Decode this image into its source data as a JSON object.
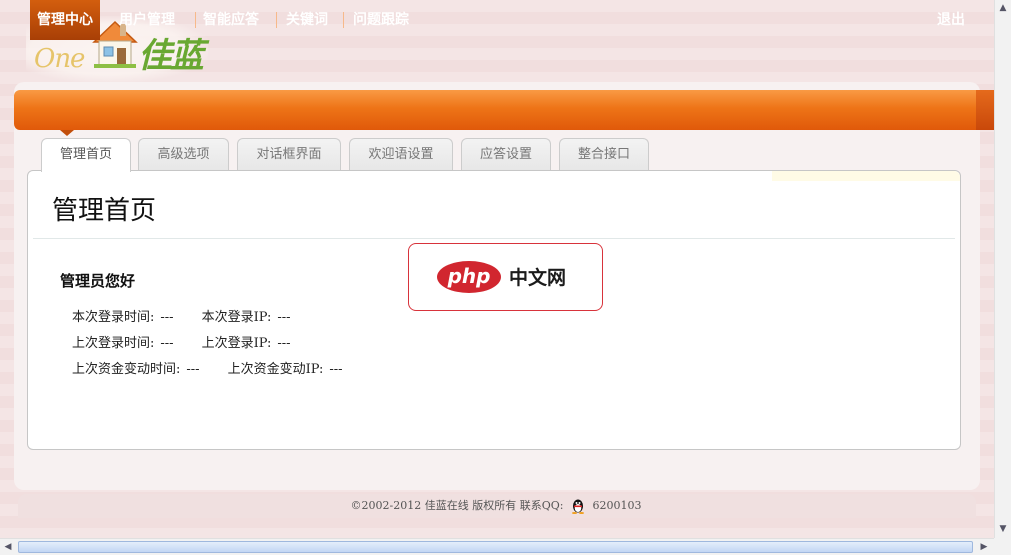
{
  "logo": {
    "one_text": "One",
    "brand_text": "佳蓝",
    "house_icon": "house-icon"
  },
  "nav": {
    "items": [
      {
        "label": "管理中心",
        "active": true
      },
      {
        "label": "用户管理"
      },
      {
        "label": "智能应答"
      },
      {
        "label": "关键词"
      },
      {
        "label": "问题跟踪"
      }
    ],
    "logout_label": "退出"
  },
  "tabs": [
    {
      "label": "管理首页",
      "active": true
    },
    {
      "label": "高级选项"
    },
    {
      "label": "对话框界面"
    },
    {
      "label": "欢迎语设置"
    },
    {
      "label": "应答设置"
    },
    {
      "label": "整合接口"
    }
  ],
  "main": {
    "title": "管理首页",
    "greeting": "管理员您好",
    "rows": [
      {
        "label1": "本次登录时间:",
        "value1": "---",
        "label2": "本次登录IP:",
        "value2": "---"
      },
      {
        "label1": "上次登录时间:",
        "value1": "---",
        "label2": "上次登录IP:",
        "value2": "---"
      },
      {
        "label1": "上次资金变动时间:",
        "value1": "---",
        "label2": "上次资金变动IP:",
        "value2": "---"
      }
    ]
  },
  "watermark": {
    "pill": "php",
    "text": "中文网"
  },
  "footer": {
    "copyright": "©2002-2012 佳蓝在线 版权所有 联系QQ:",
    "qq_icon": "qq-penguin-icon",
    "qq_number": "6200103"
  },
  "colors": {
    "nav_orange": "#ee7417",
    "nav_active": "#a83f06",
    "brand_green": "#69a832",
    "watermark_red": "#d1262f"
  }
}
